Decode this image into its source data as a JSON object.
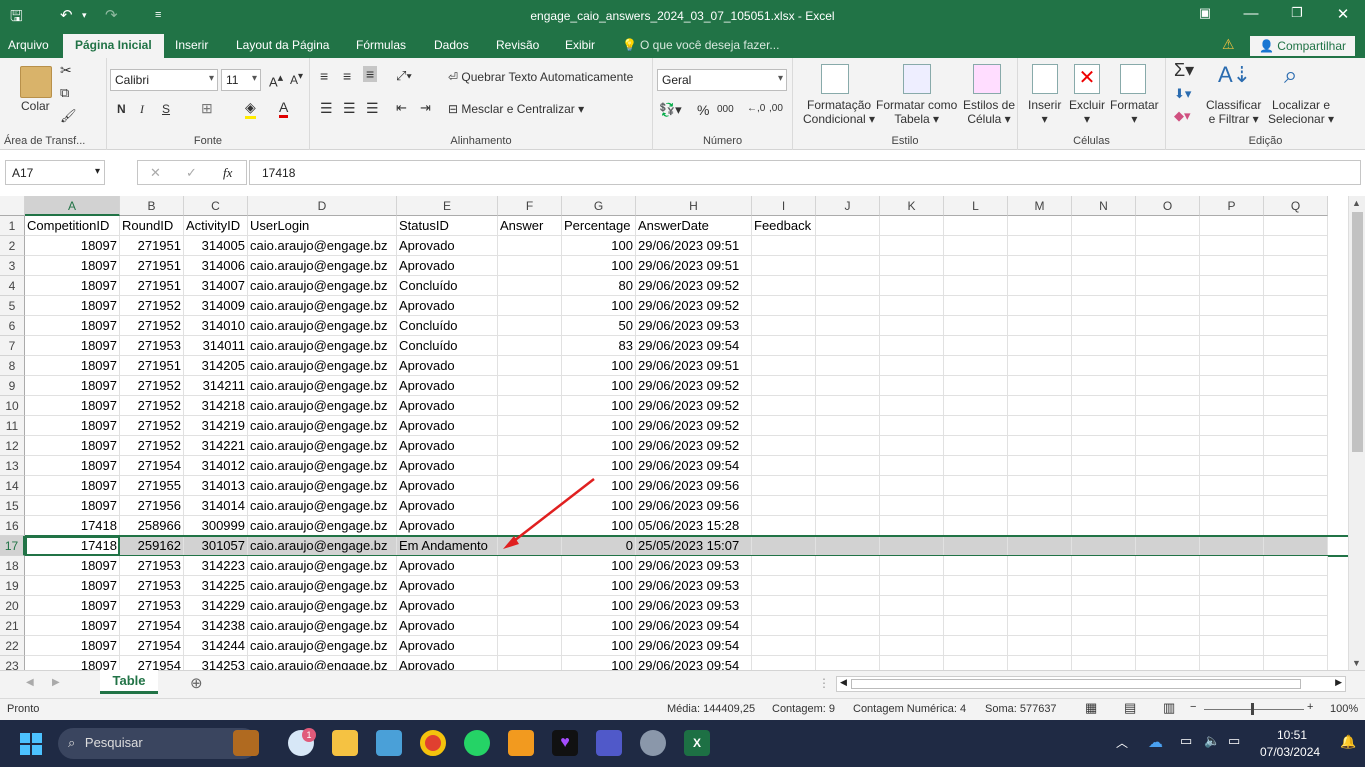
{
  "window": {
    "title": "engage_caio_answers_2024_03_07_105051.xlsx - Excel"
  },
  "tabs": [
    "Arquivo",
    "Página Inicial",
    "Inserir",
    "Layout da Página",
    "Fórmulas",
    "Dados",
    "Revisão",
    "Exibir"
  ],
  "active_tab": "Página Inicial",
  "tell_me": "O que você deseja fazer...",
  "share": "Compartilhar",
  "ribbon": {
    "clipboard": {
      "paste": "Colar",
      "label": "Área de Transf..."
    },
    "font": {
      "name": "Calibri",
      "size": "11",
      "label": "Fonte",
      "bold": "N",
      "italic": "I",
      "underline": "S"
    },
    "alignment": {
      "wrap": "Quebrar Texto Automaticamente",
      "merge": "Mesclar e Centralizar",
      "label": "Alinhamento"
    },
    "number": {
      "format": "Geral",
      "percent": "%",
      "thousands": "000",
      "label": "Número"
    },
    "styles": {
      "conditional": "Formatação",
      "conditional2": "Condicional",
      "table": "Formatar como",
      "table2": "Tabela",
      "cell_styles": "Estilos de",
      "cell_styles2": "Célula",
      "label": "Estilo"
    },
    "cells": {
      "insert": "Inserir",
      "delete": "Excluir",
      "format": "Formatar",
      "label": "Células"
    },
    "editing": {
      "sort": "Classificar",
      "sort2": "e Filtrar",
      "find": "Localizar e",
      "find2": "Selecionar",
      "label": "Edição"
    }
  },
  "formula_bar": {
    "name_box": "A17",
    "fx": "fx",
    "value": "17418"
  },
  "columns": [
    "A",
    "B",
    "C",
    "D",
    "E",
    "F",
    "G",
    "H",
    "I",
    "J",
    "K",
    "L",
    "M",
    "N",
    "O",
    "P",
    "Q"
  ],
  "header_row": [
    "CompetitionID",
    "RoundID",
    "ActivityID",
    "UserLogin",
    "StatusID",
    "Answer",
    "Percentage",
    "AnswerDate",
    "Feedback"
  ],
  "rows": [
    {
      "n": "2",
      "a": "18097",
      "b": "271951",
      "c": "314005",
      "d": "caio.araujo@engage.bz",
      "e": "Aprovado",
      "g": "100",
      "h": "29/06/2023 09:51"
    },
    {
      "n": "3",
      "a": "18097",
      "b": "271951",
      "c": "314006",
      "d": "caio.araujo@engage.bz",
      "e": "Aprovado",
      "g": "100",
      "h": "29/06/2023 09:51"
    },
    {
      "n": "4",
      "a": "18097",
      "b": "271951",
      "c": "314007",
      "d": "caio.araujo@engage.bz",
      "e": "Concluído",
      "g": "80",
      "h": "29/06/2023 09:52"
    },
    {
      "n": "5",
      "a": "18097",
      "b": "271952",
      "c": "314009",
      "d": "caio.araujo@engage.bz",
      "e": "Aprovado",
      "g": "100",
      "h": "29/06/2023 09:52"
    },
    {
      "n": "6",
      "a": "18097",
      "b": "271952",
      "c": "314010",
      "d": "caio.araujo@engage.bz",
      "e": "Concluído",
      "g": "50",
      "h": "29/06/2023 09:53"
    },
    {
      "n": "7",
      "a": "18097",
      "b": "271953",
      "c": "314011",
      "d": "caio.araujo@engage.bz",
      "e": "Concluído",
      "g": "83",
      "h": "29/06/2023 09:54"
    },
    {
      "n": "8",
      "a": "18097",
      "b": "271951",
      "c": "314205",
      "d": "caio.araujo@engage.bz",
      "e": "Aprovado",
      "g": "100",
      "h": "29/06/2023 09:51"
    },
    {
      "n": "9",
      "a": "18097",
      "b": "271952",
      "c": "314211",
      "d": "caio.araujo@engage.bz",
      "e": "Aprovado",
      "g": "100",
      "h": "29/06/2023 09:52"
    },
    {
      "n": "10",
      "a": "18097",
      "b": "271952",
      "c": "314218",
      "d": "caio.araujo@engage.bz",
      "e": "Aprovado",
      "g": "100",
      "h": "29/06/2023 09:52"
    },
    {
      "n": "11",
      "a": "18097",
      "b": "271952",
      "c": "314219",
      "d": "caio.araujo@engage.bz",
      "e": "Aprovado",
      "g": "100",
      "h": "29/06/2023 09:52"
    },
    {
      "n": "12",
      "a": "18097",
      "b": "271952",
      "c": "314221",
      "d": "caio.araujo@engage.bz",
      "e": "Aprovado",
      "g": "100",
      "h": "29/06/2023 09:52"
    },
    {
      "n": "13",
      "a": "18097",
      "b": "271954",
      "c": "314012",
      "d": "caio.araujo@engage.bz",
      "e": "Aprovado",
      "g": "100",
      "h": "29/06/2023 09:54"
    },
    {
      "n": "14",
      "a": "18097",
      "b": "271955",
      "c": "314013",
      "d": "caio.araujo@engage.bz",
      "e": "Aprovado",
      "g": "100",
      "h": "29/06/2023 09:56"
    },
    {
      "n": "15",
      "a": "18097",
      "b": "271956",
      "c": "314014",
      "d": "caio.araujo@engage.bz",
      "e": "Aprovado",
      "g": "100",
      "h": "29/06/2023 09:56"
    },
    {
      "n": "16",
      "a": "17418",
      "b": "258966",
      "c": "300999",
      "d": "caio.araujo@engage.bz",
      "e": "Aprovado",
      "g": "100",
      "h": "05/06/2023 15:28"
    },
    {
      "n": "17",
      "a": "17418",
      "b": "259162",
      "c": "301057",
      "d": "caio.araujo@engage.bz",
      "e": "Em Andamento",
      "g": "0",
      "h": "25/05/2023 15:07"
    },
    {
      "n": "18",
      "a": "18097",
      "b": "271953",
      "c": "314223",
      "d": "caio.araujo@engage.bz",
      "e": "Aprovado",
      "g": "100",
      "h": "29/06/2023 09:53"
    },
    {
      "n": "19",
      "a": "18097",
      "b": "271953",
      "c": "314225",
      "d": "caio.araujo@engage.bz",
      "e": "Aprovado",
      "g": "100",
      "h": "29/06/2023 09:53"
    },
    {
      "n": "20",
      "a": "18097",
      "b": "271953",
      "c": "314229",
      "d": "caio.araujo@engage.bz",
      "e": "Aprovado",
      "g": "100",
      "h": "29/06/2023 09:53"
    },
    {
      "n": "21",
      "a": "18097",
      "b": "271954",
      "c": "314238",
      "d": "caio.araujo@engage.bz",
      "e": "Aprovado",
      "g": "100",
      "h": "29/06/2023 09:54"
    },
    {
      "n": "22",
      "a": "18097",
      "b": "271954",
      "c": "314244",
      "d": "caio.araujo@engage.bz",
      "e": "Aprovado",
      "g": "100",
      "h": "29/06/2023 09:54"
    },
    {
      "n": "23",
      "a": "18097",
      "b": "271954",
      "c": "314253",
      "d": "caio.araujo@engage.bz",
      "e": "Aprovado",
      "g": "100",
      "h": "29/06/2023 09:54"
    }
  ],
  "selected_row": "17",
  "sheet_tab": "Table",
  "status": {
    "ready": "Pronto",
    "average": "Média: 144409,25",
    "count": "Contagem: 9",
    "numcount": "Contagem Numérica: 4",
    "sum": "Soma: 577637",
    "zoom": "100%"
  },
  "taskbar": {
    "search": "Pesquisar",
    "time": "10:51",
    "date": "07/03/2024",
    "badge": "1"
  },
  "colors": {
    "excel_green": "#217346",
    "selected_row": "#d2d2d2",
    "arrow": "#e02020"
  }
}
